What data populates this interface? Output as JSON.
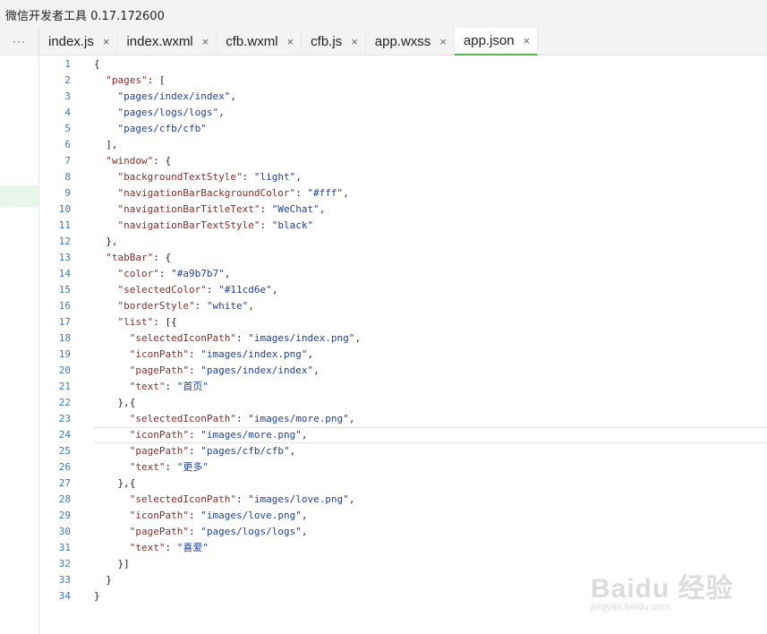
{
  "window": {
    "title": "微信开发者工具 0.17.172600"
  },
  "tabbar": {
    "more_label": "···",
    "tabs": [
      {
        "label": "index.js",
        "active": false
      },
      {
        "label": "index.wxml",
        "active": false
      },
      {
        "label": "cfb.wxml",
        "active": false
      },
      {
        "label": "cfb.js",
        "active": false
      },
      {
        "label": "app.wxss",
        "active": false
      },
      {
        "label": "app.json",
        "active": true
      }
    ],
    "close_glyph": "×"
  },
  "editor": {
    "current_line": 24,
    "lines": [
      "{",
      "  \"pages\": [",
      "    \"pages/index/index\",",
      "    \"pages/logs/logs\",",
      "    \"pages/cfb/cfb\"",
      "  ],",
      "  \"window\": {",
      "    \"backgroundTextStyle\": \"light\",",
      "    \"navigationBarBackgroundColor\": \"#fff\",",
      "    \"navigationBarTitleText\": \"WeChat\",",
      "    \"navigationBarTextStyle\": \"black\"",
      "  },",
      "  \"tabBar\": {",
      "    \"color\": \"#a9b7b7\",",
      "    \"selectedColor\": \"#11cd6e\",",
      "    \"borderStyle\": \"white\",",
      "    \"list\": [{",
      "      \"selectedIconPath\": \"images/index.png\",",
      "      \"iconPath\": \"images/index.png\",",
      "      \"pagePath\": \"pages/index/index\",",
      "      \"text\": \"首页\"",
      "    },{",
      "      \"selectedIconPath\": \"images/more.png\",",
      "      \"iconPath\": \"images/more.png\",",
      "      \"pagePath\": \"pages/cfb/cfb\",",
      "      \"text\": \"更多\"",
      "    },{",
      "      \"selectedIconPath\": \"images/love.png\",",
      "      \"iconPath\": \"images/love.png\",",
      "      \"pagePath\": \"pages/logs/logs\",",
      "      \"text\": \"喜爱\"",
      "    }]",
      "  }",
      "}"
    ]
  },
  "watermark": {
    "brand": "Baidu 经验",
    "url": "jingyan.baidu.com"
  },
  "colors": {
    "accent": "#55b94a",
    "line_number": "#3b78b5",
    "key": "#8a2b2b",
    "string": "#1f3f9a"
  }
}
